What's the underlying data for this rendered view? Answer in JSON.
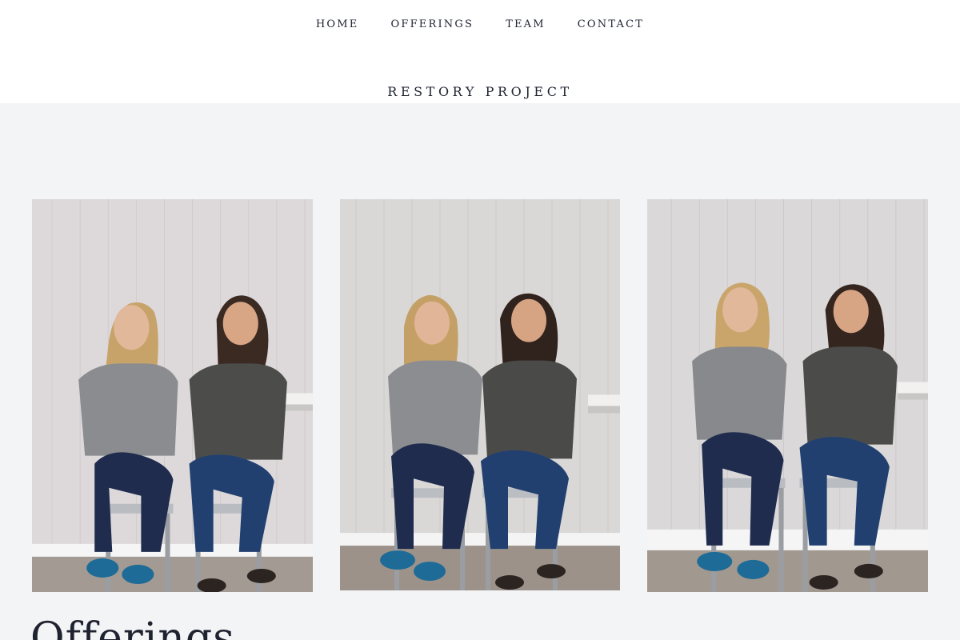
{
  "nav": {
    "items": [
      {
        "label": "HOME"
      },
      {
        "label": "OFFERINGS"
      },
      {
        "label": "TEAM"
      },
      {
        "label": "CONTACT"
      }
    ]
  },
  "brand": {
    "name": "RESTORY PROJECT"
  },
  "gallery": {
    "photos": [
      {
        "subject": "two women seated on metal stools, one looking aside"
      },
      {
        "subject": "two women seated on metal stools, both smiling at camera"
      },
      {
        "subject": "two women seated on metal stools, laughing"
      }
    ]
  },
  "section": {
    "title": "Offerings"
  },
  "colors": {
    "header_bg": "#ffffff",
    "page_bg": "#f3f4f6",
    "text": "#1f2330"
  }
}
